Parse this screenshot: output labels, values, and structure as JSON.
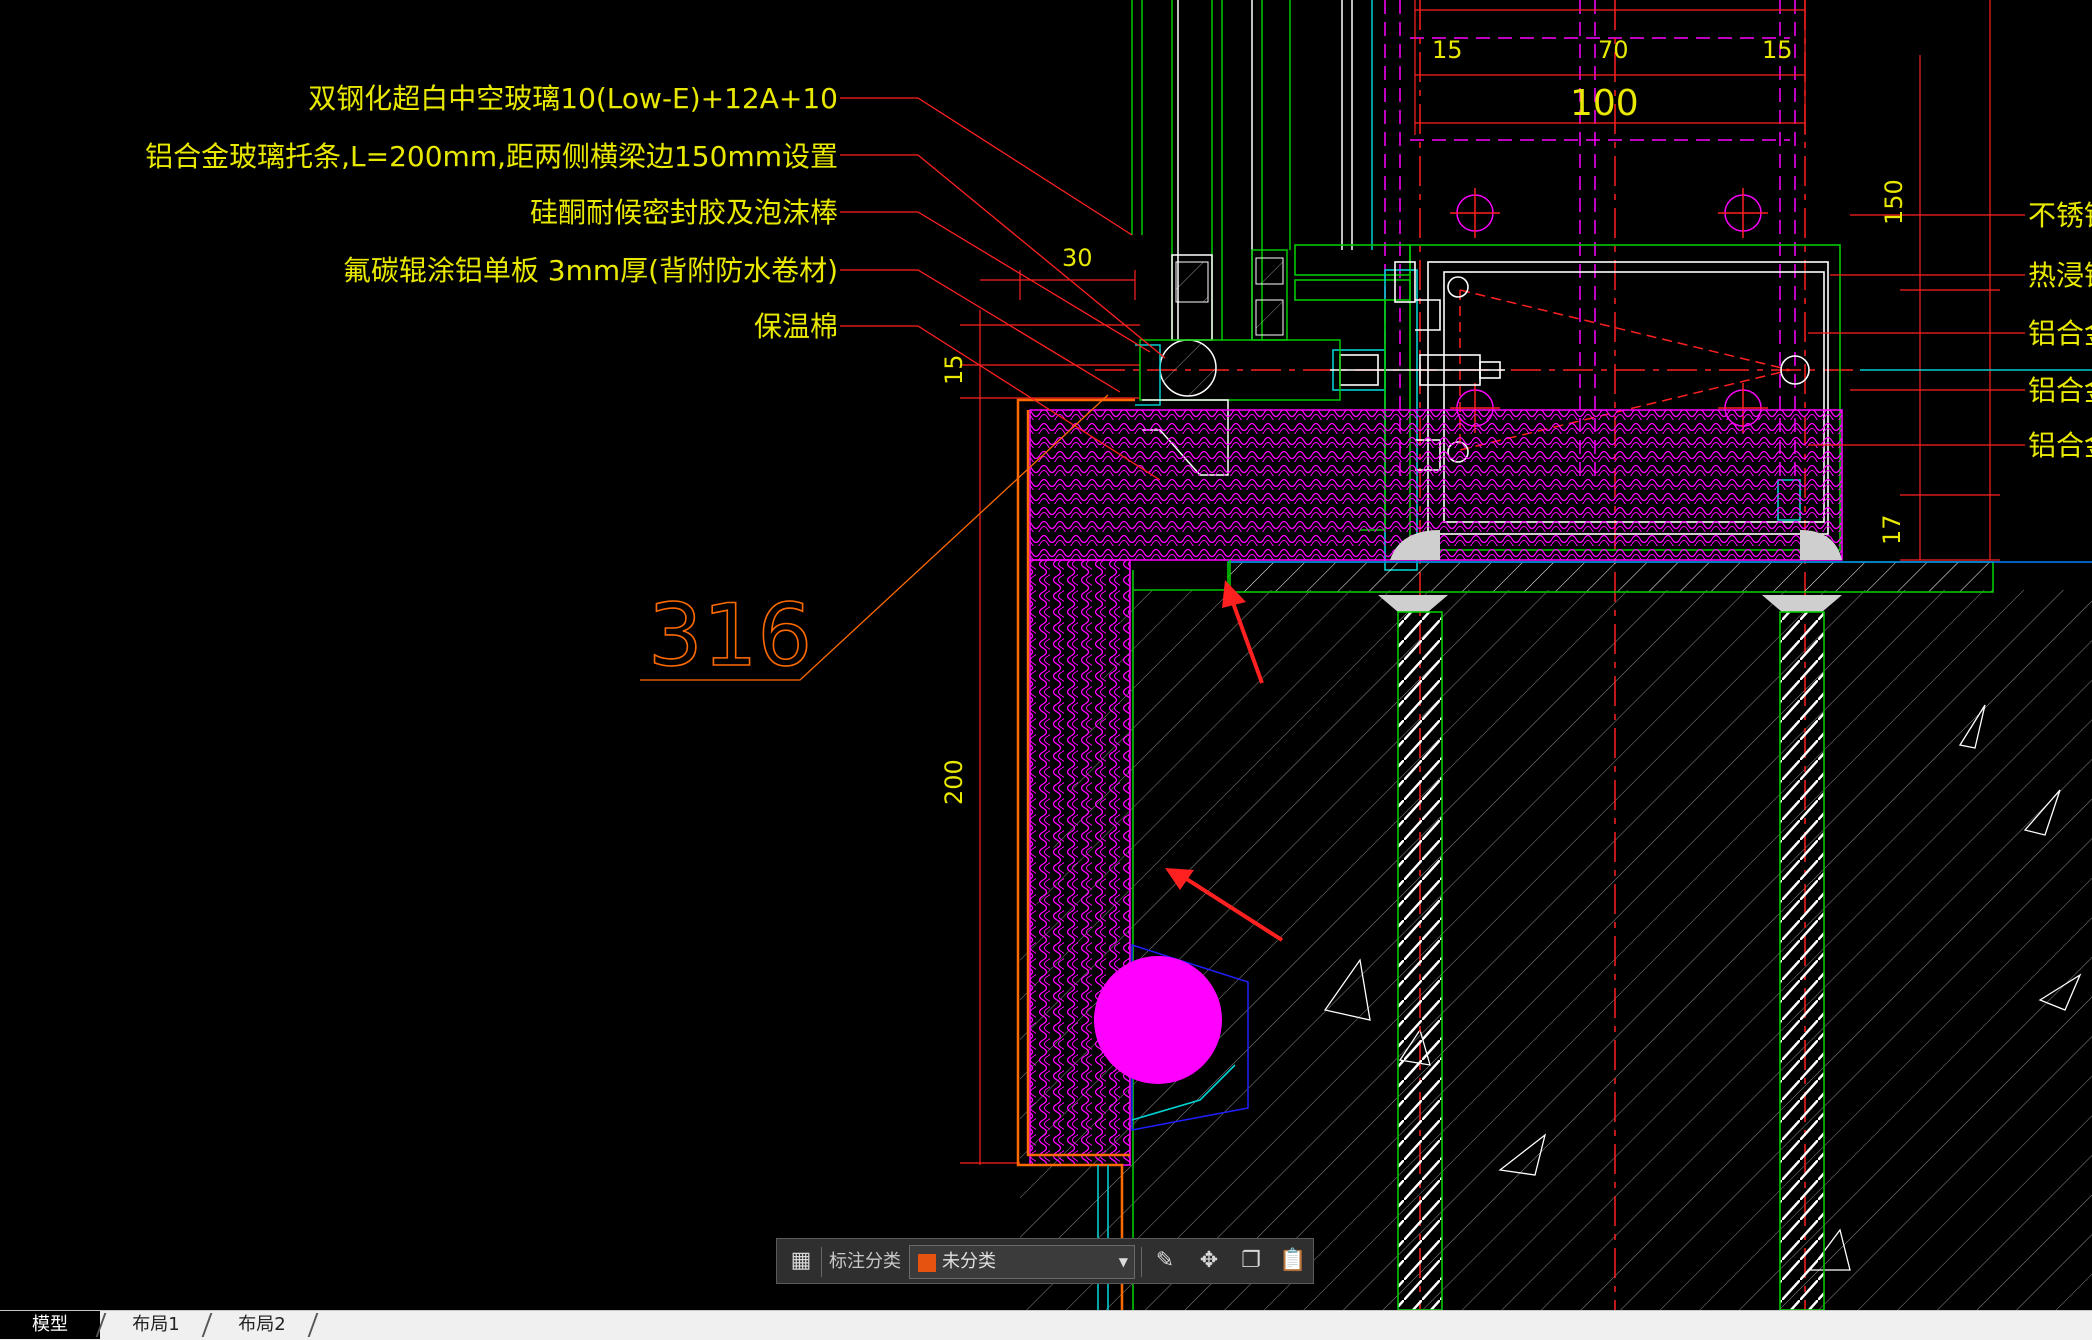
{
  "drawing": {
    "callouts": [
      "双钢化超白中空玻璃10(Low-E)+12A+10",
      "铝合金玻璃托条,L=200mm,距两侧横梁边150mm设置",
      "硅酮耐候密封胶及泡沫棒",
      "氟碳辊涂铝单板 3mm厚(背附防水卷材)",
      "保温棉"
    ],
    "right_callouts": [
      "不锈钢螺",
      "热浸镀锌",
      "铝合金",
      "铝合金横",
      "铝合金横"
    ],
    "dimensions": {
      "d15a": "15",
      "d70": "70",
      "d15b": "15",
      "d100": "100",
      "d150": "150",
      "d30": "30",
      "d15c": "15",
      "d200": "200",
      "d17": "17"
    },
    "big_label": "316",
    "colors": {
      "yellow": "#e8e800",
      "green": "#00c800",
      "red": "#ff2020",
      "magenta": "#ff00ff",
      "orange": "#ff6a00",
      "cyan": "#00d0d0",
      "white": "#ffffff"
    }
  },
  "toolbar": {
    "grid_icon": "grid-icon",
    "category_label": "标注分类",
    "category_value": "未分类",
    "icons": [
      "edit-icon",
      "move-icon",
      "copy-icon",
      "paste-icon"
    ]
  },
  "tabs": [
    "模型",
    "布局1",
    "布局2"
  ]
}
